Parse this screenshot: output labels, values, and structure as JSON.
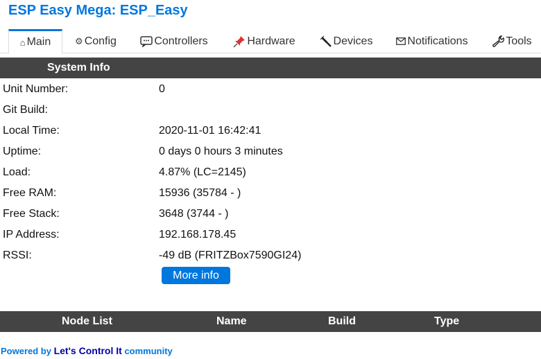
{
  "app": {
    "title": "ESP Easy Mega: ESP_Easy"
  },
  "tabs": [
    {
      "label": "Main",
      "icon": "home-icon",
      "active": true
    },
    {
      "label": "Config",
      "icon": "gear-icon",
      "active": false
    },
    {
      "label": "Controllers",
      "icon": "chat-icon",
      "active": false
    },
    {
      "label": "Hardware",
      "icon": "pushpin-icon",
      "active": false
    },
    {
      "label": "Devices",
      "icon": "plug-icon",
      "active": false
    },
    {
      "label": "Notifications",
      "icon": "envelope-icon",
      "active": false
    },
    {
      "label": "Tools",
      "icon": "wrench-icon",
      "active": false
    }
  ],
  "system_info": {
    "header": "System Info",
    "rows": [
      {
        "label": "Unit Number:",
        "value": "0"
      },
      {
        "label": "Git Build:",
        "value": ""
      },
      {
        "label": "Local Time:",
        "value": "2020-11-01 16:42:41"
      },
      {
        "label": "Uptime:",
        "value": "0 days 0 hours 3 minutes"
      },
      {
        "label": "Load:",
        "value": "4.87% (LC=2145)"
      },
      {
        "label": "Free RAM:",
        "value": "15936 (35784 - )"
      },
      {
        "label": "Free Stack:",
        "value": "3648 (3744 - )"
      },
      {
        "label": "IP Address:",
        "value": "192.168.178.45"
      },
      {
        "label": "RSSI:",
        "value": "-49 dB (FRITZBox7590GI24)"
      }
    ],
    "more_button": "More info"
  },
  "node_list": {
    "columns": [
      "Node List",
      "Name",
      "Build",
      "Type"
    ]
  },
  "footer": {
    "prefix": "Powered by",
    "link": "Let's Control It",
    "suffix": "community"
  },
  "colors": {
    "accent": "#0077dd",
    "header_bar": "#444444",
    "footer_link": "#0000aa"
  }
}
